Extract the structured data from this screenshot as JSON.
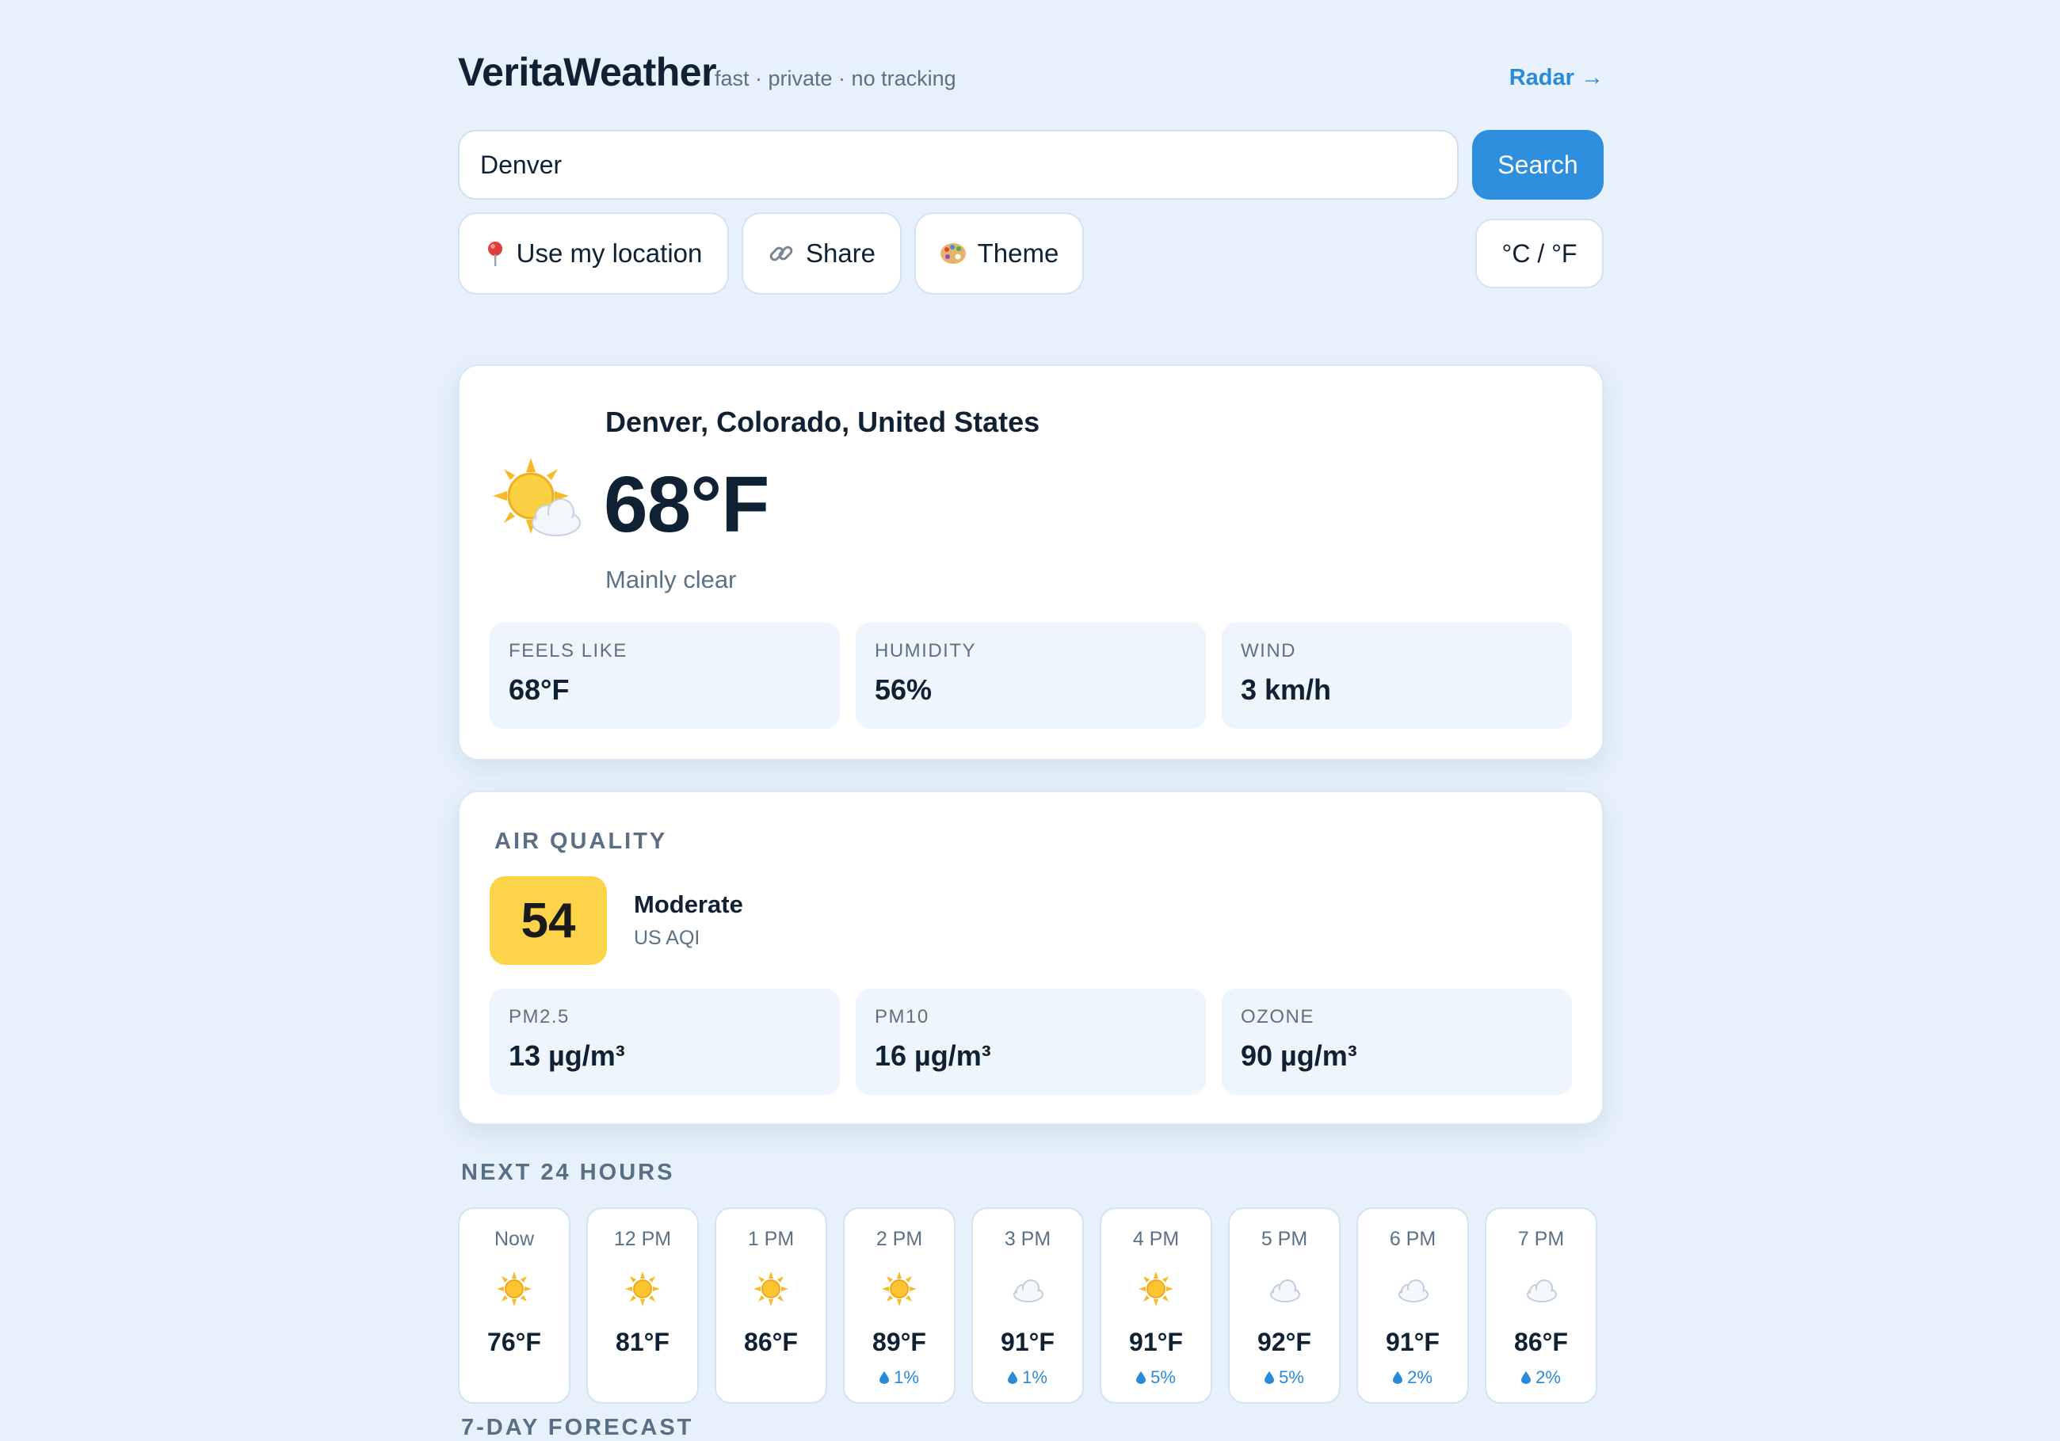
{
  "header": {
    "brand": "VeritaWeather",
    "tagline": "fast · private · no tracking",
    "radar_link": "Radar →"
  },
  "search": {
    "value": "Denver",
    "button_label": "Search"
  },
  "actions": {
    "use_location": {
      "label": "Use my location",
      "icon": "pin-icon"
    },
    "share": {
      "label": "Share",
      "icon": "link-icon"
    },
    "theme": {
      "label": "Theme",
      "icon": "palette-icon"
    },
    "unit_toggle": "°C / °F"
  },
  "current": {
    "location": "Denver, Colorado, United States",
    "temperature": "68°F",
    "condition": "Mainly clear",
    "icon": "sun-behind-cloud-icon",
    "stats": [
      {
        "label": "Feels like",
        "value": "68°F"
      },
      {
        "label": "Humidity",
        "value": "56%"
      },
      {
        "label": "Wind",
        "value": "3 km/h"
      }
    ]
  },
  "air_quality": {
    "heading": "AIR QUALITY",
    "aqi": "54",
    "category": "Moderate",
    "scale": "US AQI",
    "badge_color": "#fdd449",
    "stats": [
      {
        "label": "PM2.5",
        "value": "13 µg/m³"
      },
      {
        "label": "PM10",
        "value": "16 µg/m³"
      },
      {
        "label": "Ozone",
        "value": "90 µg/m³"
      }
    ]
  },
  "hourly": {
    "heading": "NEXT 24 HOURS",
    "items": [
      {
        "time": "Now",
        "icon": "sun-icon",
        "temp": "76°F",
        "precip": ""
      },
      {
        "time": "12 PM",
        "icon": "sun-icon",
        "temp": "81°F",
        "precip": ""
      },
      {
        "time": "1 PM",
        "icon": "sun-icon",
        "temp": "86°F",
        "precip": ""
      },
      {
        "time": "2 PM",
        "icon": "sun-icon",
        "temp": "89°F",
        "precip": "1%"
      },
      {
        "time": "3 PM",
        "icon": "cloud-icon",
        "temp": "91°F",
        "precip": "1%"
      },
      {
        "time": "4 PM",
        "icon": "sun-icon",
        "temp": "91°F",
        "precip": "5%"
      },
      {
        "time": "5 PM",
        "icon": "cloud-icon",
        "temp": "92°F",
        "precip": "5%"
      },
      {
        "time": "6 PM",
        "icon": "cloud-icon",
        "temp": "91°F",
        "precip": "2%"
      },
      {
        "time": "7 PM",
        "icon": "cloud-icon",
        "temp": "86°F",
        "precip": "2%"
      }
    ]
  },
  "next_heading": "7-DAY FORECAST",
  "colors": {
    "accent": "#2f8fdf",
    "background": "#e6f1fb",
    "stat_bg": "#eef5fd"
  }
}
